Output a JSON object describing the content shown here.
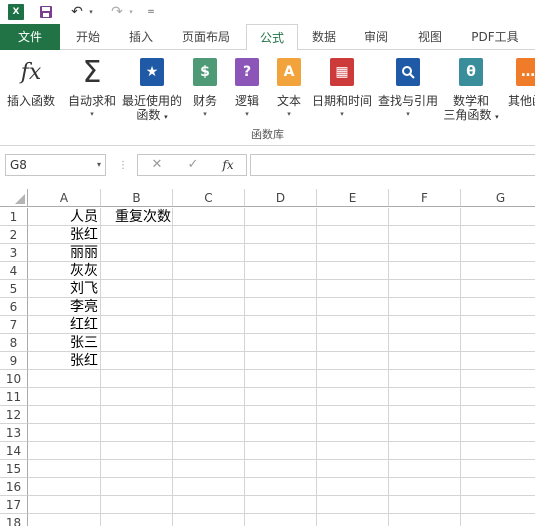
{
  "quick_access": {
    "excel_logo": "X",
    "undo_glyph": "↶",
    "redo_glyph": "↷",
    "dropdown_glyph": "▾",
    "customize_glyph": "="
  },
  "tabs": [
    {
      "label": "文件"
    },
    {
      "label": "开始"
    },
    {
      "label": "插入"
    },
    {
      "label": "页面布局"
    },
    {
      "label": "公式"
    },
    {
      "label": "数据"
    },
    {
      "label": "审阅"
    },
    {
      "label": "视图"
    },
    {
      "label": "PDF工具"
    }
  ],
  "ribbon": {
    "group_label": "函数库",
    "buttons": [
      {
        "line1": "插入函数",
        "line2": "",
        "icon": "fx",
        "has_dropdown": false
      },
      {
        "line1": "自动求和",
        "line2": "",
        "icon": "Σ",
        "has_dropdown": true
      },
      {
        "line1": "最近使用的",
        "line2": "函数",
        "icon": "★",
        "has_dropdown": true
      },
      {
        "line1": "财务",
        "line2": "",
        "icon": "$",
        "has_dropdown": true
      },
      {
        "line1": "逻辑",
        "line2": "",
        "icon": "?",
        "has_dropdown": true
      },
      {
        "line1": "文本",
        "line2": "",
        "icon": "A",
        "has_dropdown": true
      },
      {
        "line1": "日期和时间",
        "line2": "",
        "icon": "▦",
        "has_dropdown": true
      },
      {
        "line1": "查找与引用",
        "line2": "",
        "icon": "🔍",
        "has_dropdown": true
      },
      {
        "line1": "数学和",
        "line2": "三角函数",
        "icon": "θ",
        "has_dropdown": true
      },
      {
        "line1": "其他函",
        "line2": "",
        "icon": "…",
        "has_dropdown": false
      }
    ]
  },
  "formula_bar": {
    "name_box": "G8",
    "cancel_glyph": "✕",
    "enter_glyph": "✓",
    "fx_label": "fx",
    "separator_glyph": "⋮",
    "formula_value": ""
  },
  "sheet": {
    "columns": [
      "A",
      "B",
      "C",
      "D",
      "E",
      "F",
      "G"
    ],
    "rows": [
      "1",
      "2",
      "3",
      "4",
      "5",
      "6",
      "7",
      "8",
      "9",
      "10",
      "11",
      "12",
      "13",
      "14",
      "15",
      "16",
      "17",
      "18"
    ],
    "cells": {
      "A1": "人员",
      "B1": "重复次数",
      "A2": "张红",
      "A3": "丽丽",
      "A4": "灰灰",
      "A5": "刘飞",
      "A6": "李亮",
      "A7": "红红",
      "A8": "张三",
      "A9": "张红"
    }
  },
  "colors": {
    "file_tab": "#217346",
    "accent": "#217346",
    "icon_blue": "#1f5aa6",
    "icon_green": "#4f9a76",
    "icon_purple": "#8c55b8",
    "icon_orange": "#f2a33b",
    "icon_red": "#cc3a3a",
    "icon_teal": "#3a8d9a"
  }
}
